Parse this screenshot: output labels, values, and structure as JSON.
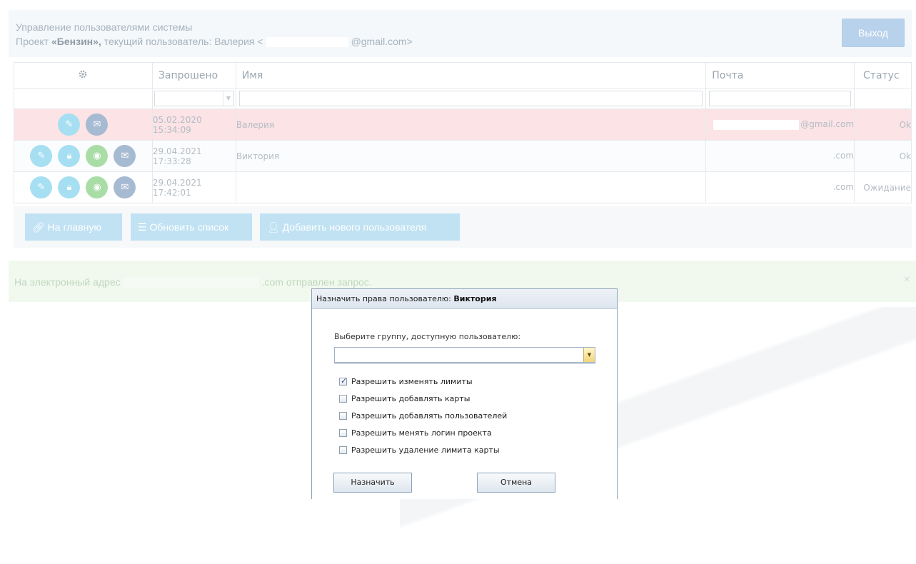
{
  "header": {
    "title": "Управление пользователями системы",
    "project_prefix": "Проект ",
    "project_name": "«Бензин»,",
    "current_user_text": " текущий пользователь: Валерия <",
    "current_user_email_suffix": "@gmail.com>",
    "logout_label": "Выход"
  },
  "table": {
    "columns": {
      "settings_icon": "gear-icon",
      "requested": "Запрошено",
      "name": "Имя",
      "email": "Почта",
      "status": "Статус"
    },
    "rows": [
      {
        "date": "05.02.2020",
        "time": "15:34:09",
        "name": "Валерия",
        "email": "@gmail.com",
        "status": "Ok"
      },
      {
        "date": "29.04.2021",
        "time": "17:33:28",
        "name": "Виктория",
        "email": ".com",
        "status": "Ok"
      },
      {
        "date": "29.04.2021",
        "time": "17:42:01",
        "name": "",
        "email": ".com",
        "status": "Ожидание"
      }
    ]
  },
  "toolbar": {
    "home_label": "На главную",
    "refresh_label": "Обновить список",
    "add_user_label": "Добавить нового пользователя"
  },
  "notice": {
    "prefix": "На электронный адрес",
    "suffix": ".com отправлен запрос.",
    "close": "×"
  },
  "dialog": {
    "title_prefix": "Назначить права пользователю: ",
    "title_user": "Виктория",
    "group_label": "Выберите группу, доступную пользователю:",
    "group_value": "",
    "permissions": [
      {
        "label": "Разрешить изменять лимиты",
        "checked": true
      },
      {
        "label": "Разрешить добавлять карты",
        "checked": false
      },
      {
        "label": "Разрешить добавлять пользователей",
        "checked": false
      },
      {
        "label": "Разрешить менять логин проекта",
        "checked": false
      },
      {
        "label": "Разрешить удаление лимита карты",
        "checked": false
      }
    ],
    "assign_label": "Назначить",
    "cancel_label": "Отмена"
  },
  "colors": {
    "accent_blue": "#c0e2f3",
    "highlight_row": "#fbe3e6",
    "status_ok": "#bfe0a9",
    "status_wait": "#a7cbe9"
  }
}
